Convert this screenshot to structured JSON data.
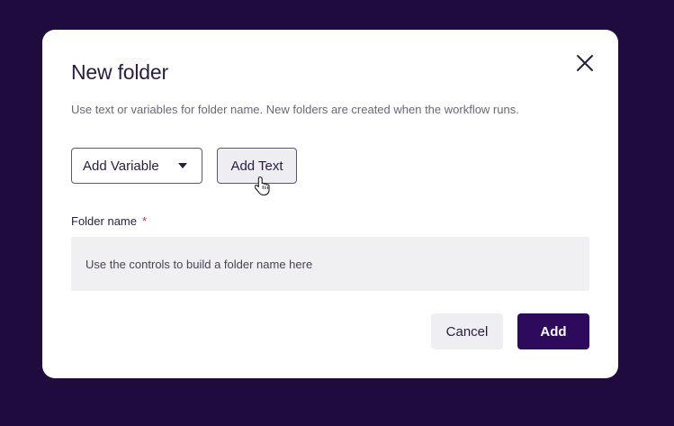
{
  "dialog": {
    "title": "New folder",
    "description": "Use text or variables for folder name. New folders are created when the workflow runs.",
    "close_icon": "close-icon"
  },
  "controls": {
    "add_variable_label": "Add Variable",
    "add_text_label": "Add Text"
  },
  "folder_name": {
    "label": "Folder name",
    "required_mark": "*",
    "placeholder": "Use the controls to build a folder name here"
  },
  "footer": {
    "cancel_label": "Cancel",
    "add_label": "Add"
  },
  "colors": {
    "backdrop": "#1f0b3e",
    "primary": "#2d0a5c",
    "required": "#d6294e"
  }
}
